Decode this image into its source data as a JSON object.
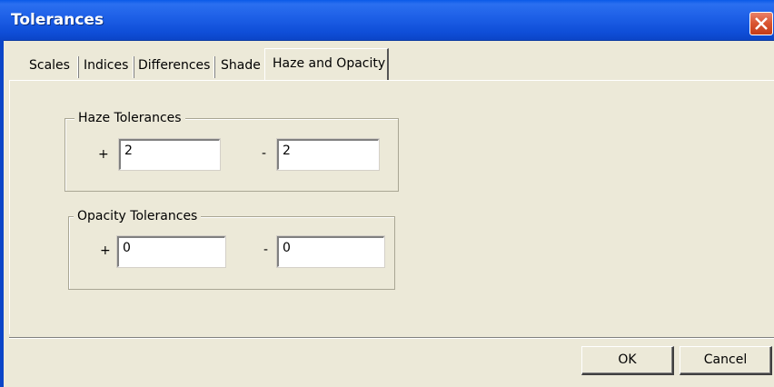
{
  "window": {
    "title": "Tolerances"
  },
  "tabs": [
    {
      "label": "Scales"
    },
    {
      "label": "Indices"
    },
    {
      "label": "Differences"
    },
    {
      "label": "Shade"
    },
    {
      "label": "Haze and Opacity",
      "active": true
    }
  ],
  "haze": {
    "legend": "Haze Tolerances",
    "plus_sign": "+",
    "plus_value": "2",
    "minus_sign": "-",
    "minus_value": "2"
  },
  "opacity": {
    "legend": "Opacity Tolerances",
    "plus_sign": "+",
    "plus_value": "0",
    "minus_sign": "-",
    "minus_value": "0"
  },
  "buttons": {
    "ok": "OK",
    "cancel": "Cancel"
  }
}
